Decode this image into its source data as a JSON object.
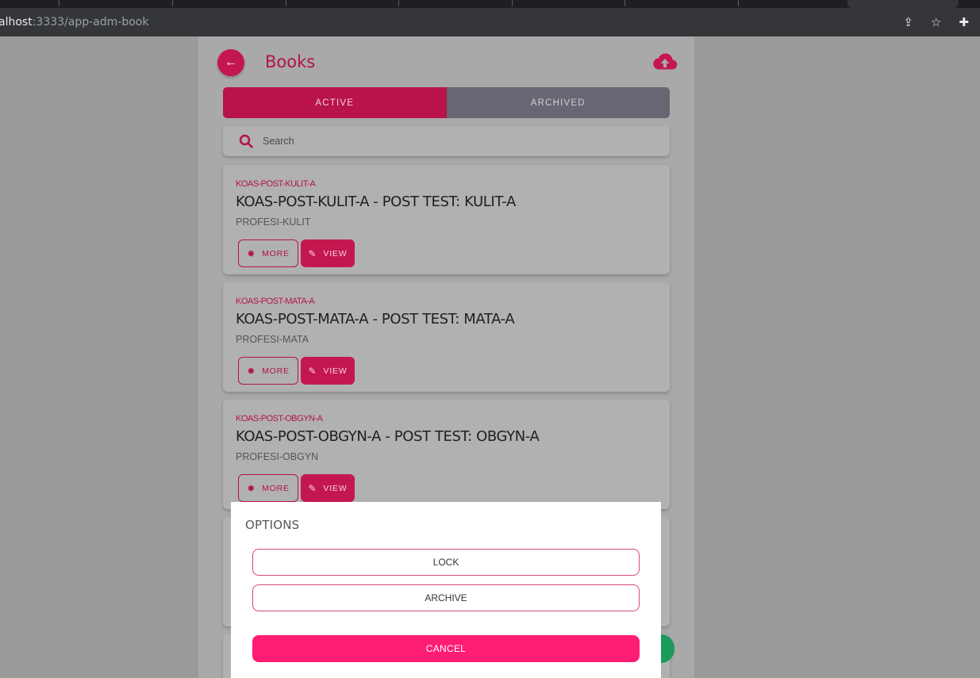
{
  "browser": {
    "url_host": "alhost",
    "url_rest": ":3333/app-adm-book",
    "icons": [
      "share-icon",
      "star-icon",
      "extension-icon"
    ]
  },
  "header": {
    "title": "Books",
    "back_icon": "arrow-left-icon",
    "upload_icon": "cloud-upload-icon",
    "accent": "#c5174f"
  },
  "tabs": [
    {
      "label": "ACTIVE",
      "active": true
    },
    {
      "label": "ARCHIVED",
      "active": false
    }
  ],
  "search": {
    "placeholder": "Search"
  },
  "books": [
    {
      "code": "KOAS-POST-KULIT-A",
      "title": "KOAS-POST-KULIT-A - POST TEST: KULIT-A",
      "subtitle": "PROFESI-KULIT",
      "more_label": "MORE",
      "view_label": "VIEW"
    },
    {
      "code": "KOAS-POST-MATA-A",
      "title": "KOAS-POST-MATA-A - POST TEST: MATA-A",
      "subtitle": "PROFESI-MATA",
      "more_label": "MORE",
      "view_label": "VIEW"
    },
    {
      "code": "KOAS-POST-OBGYN-A",
      "title": "KOAS-POST-OBGYN-A - POST TEST: OBGYN-A",
      "subtitle": "PROFESI-OBGYN",
      "more_label": "MORE",
      "view_label": "VIEW"
    }
  ],
  "modal": {
    "title": "OPTIONS",
    "lock_label": "LOCK",
    "archive_label": "ARCHIVE",
    "cancel_label": "CANCEL",
    "cancel_color": "#ff1c73"
  }
}
